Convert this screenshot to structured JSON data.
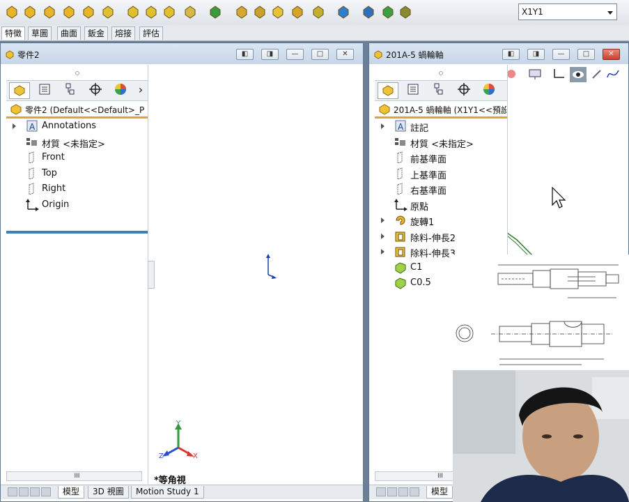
{
  "colors": {
    "accent_yellow": "#e0a52c",
    "tree_bar_blue": "#3d7fb6",
    "title_bg": "#c7d6e8",
    "close_red": "#c7402c"
  },
  "toolbar": {
    "icons": [
      "extruded-boss-icon",
      "revolved-boss-icon",
      "swept-boss-icon",
      "lofted-boss-icon",
      "boundary-boss-icon",
      "extruded-cut-icon",
      "revolved-cut-icon",
      "swept-cut-icon",
      "lofted-cut-icon",
      "fillet-icon",
      "linear-pattern-icon",
      "rib-icon",
      "draft-icon",
      "shell-icon",
      "wrap-icon",
      "intersect-icon",
      "reference-geometry-icon",
      "curves-icon",
      "instant3d-icon",
      "measure-icon"
    ],
    "config_select": {
      "value": "X1Y1"
    }
  },
  "tabs": [
    "特徵",
    "草圖",
    "曲面",
    "鈑金",
    "熔接",
    "評估"
  ],
  "left_window": {
    "title": "零件2",
    "tree_root": "零件2  (Default<<Default>_P",
    "nodes": [
      {
        "label": "Annotations",
        "icon": "annotations-icon",
        "expandable": true
      },
      {
        "label": "材質 <未指定>",
        "icon": "material-icon",
        "expandable": false
      },
      {
        "label": "Front",
        "icon": "plane-icon",
        "expandable": false
      },
      {
        "label": "Top",
        "icon": "plane-icon",
        "expandable": false
      },
      {
        "label": "Right",
        "icon": "plane-icon",
        "expandable": false
      },
      {
        "label": "Origin",
        "icon": "origin-icon",
        "expandable": false
      }
    ],
    "view_label": "*等角視",
    "bottom_tabs": [
      "模型",
      "3D 視圖",
      "Motion Study 1"
    ],
    "scroll_mark": "III"
  },
  "right_window": {
    "title": "201A-5 蝸輪軸",
    "tree_root": "201A-5 蝸輪軸  (X1Y1<<預設",
    "nodes": [
      {
        "label": "註記",
        "icon": "annotations-icon",
        "expandable": true
      },
      {
        "label": "材質 <未指定>",
        "icon": "material-icon",
        "expandable": false
      },
      {
        "label": "前基準面",
        "icon": "plane-icon",
        "expandable": false
      },
      {
        "label": "上基準面",
        "icon": "plane-icon",
        "expandable": false
      },
      {
        "label": "右基準面",
        "icon": "plane-icon",
        "expandable": false
      },
      {
        "label": "原點",
        "icon": "origin-icon",
        "expandable": false
      },
      {
        "label": "旋轉1",
        "icon": "revolve-feature-icon",
        "expandable": true
      },
      {
        "label": "除料-伸長2",
        "icon": "cut-extrude-icon",
        "expandable": true
      },
      {
        "label": "除料-伸長3",
        "icon": "cut-extrude-icon",
        "expandable": true
      },
      {
        "label": "C1",
        "icon": "chamfer-icon",
        "expandable": false
      },
      {
        "label": "C0.5",
        "icon": "chamfer-icon",
        "expandable": false
      }
    ],
    "bottom_tabs": [
      "模型"
    ],
    "scroll_mark": "III"
  },
  "triad": {
    "x": "X",
    "y": "Y",
    "z": "Z"
  }
}
